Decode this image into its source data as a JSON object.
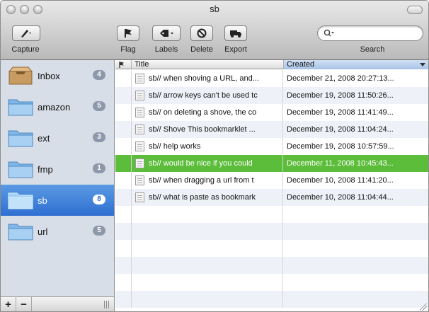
{
  "window": {
    "title": "sb"
  },
  "toolbar": {
    "capture_label": "Capture",
    "flag_label": "Flag",
    "labels_label": "Labels",
    "delete_label": "Delete",
    "export_label": "Export",
    "search_label": "Search",
    "search_placeholder": ""
  },
  "sidebar": {
    "items": [
      {
        "label": "Inbox",
        "count": "4",
        "icon": "inbox-icon",
        "selected": false
      },
      {
        "label": "amazon",
        "count": "5",
        "icon": "folder-icon",
        "selected": false
      },
      {
        "label": "ext",
        "count": "3",
        "icon": "folder-icon",
        "selected": false
      },
      {
        "label": "fmp",
        "count": "1",
        "icon": "folder-icon",
        "selected": false
      },
      {
        "label": "sb",
        "count": "8",
        "icon": "folder-icon",
        "selected": true
      },
      {
        "label": "url",
        "count": "5",
        "icon": "folder-icon",
        "selected": false
      }
    ],
    "add_label": "+",
    "remove_label": "−"
  },
  "table": {
    "columns": {
      "flag": "",
      "title": "Title",
      "created": "Created"
    },
    "rows": [
      {
        "title": "sb// when shoving a URL, and...",
        "created": "December 21, 2008 20:27:13..."
      },
      {
        "title": "sb// arrow keys can't be used tc",
        "created": "December 19, 2008 11:50:26..."
      },
      {
        "title": "sb// on deleting a shove, the co",
        "created": "December 19, 2008 11:41:49..."
      },
      {
        "title": "sb// Shove This bookmarklet ...",
        "created": "December 19, 2008 11:04:24..."
      },
      {
        "title": "sb// help works",
        "created": "December 19, 2008 10:57:59..."
      },
      {
        "title": "sb// would be nice if you could",
        "created": "December 11, 2008 10:45:43..."
      },
      {
        "title": "sb// when dragging a url from t",
        "created": "December 10, 2008 11:41:20..."
      },
      {
        "title": "sb// what is paste as bookmark",
        "created": "December 10, 2008 11:04:44..."
      }
    ],
    "selected_index": 5
  },
  "colors": {
    "selection_green": "#5cbd3b",
    "sidebar_selection_blue": "#2f6fd1",
    "sidebar_bg": "#d8dee7",
    "alt_row": "#eef2f8"
  }
}
